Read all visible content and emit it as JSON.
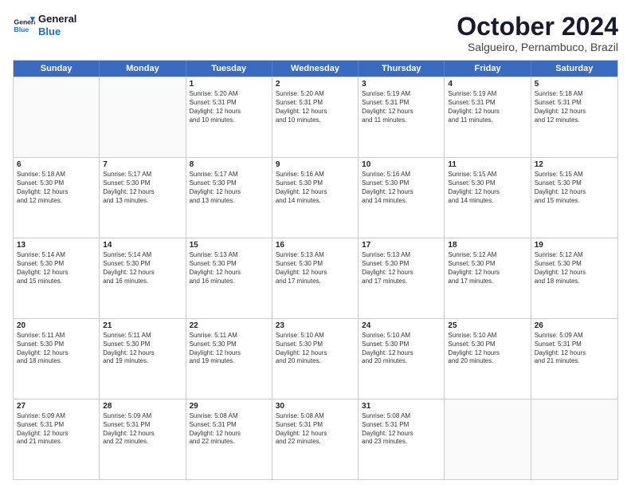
{
  "logo": {
    "line1": "General",
    "line2": "Blue"
  },
  "title": "October 2024",
  "location": "Salgueiro, Pernambuco, Brazil",
  "header_days": [
    "Sunday",
    "Monday",
    "Tuesday",
    "Wednesday",
    "Thursday",
    "Friday",
    "Saturday"
  ],
  "weeks": [
    [
      {
        "day": "",
        "text": ""
      },
      {
        "day": "",
        "text": ""
      },
      {
        "day": "1",
        "text": "Sunrise: 5:20 AM\nSunset: 5:31 PM\nDaylight: 12 hours\nand 10 minutes."
      },
      {
        "day": "2",
        "text": "Sunrise: 5:20 AM\nSunset: 5:31 PM\nDaylight: 12 hours\nand 10 minutes."
      },
      {
        "day": "3",
        "text": "Sunrise: 5:19 AM\nSunset: 5:31 PM\nDaylight: 12 hours\nand 11 minutes."
      },
      {
        "day": "4",
        "text": "Sunrise: 5:19 AM\nSunset: 5:31 PM\nDaylight: 12 hours\nand 11 minutes."
      },
      {
        "day": "5",
        "text": "Sunrise: 5:18 AM\nSunset: 5:31 PM\nDaylight: 12 hours\nand 12 minutes."
      }
    ],
    [
      {
        "day": "6",
        "text": "Sunrise: 5:18 AM\nSunset: 5:30 PM\nDaylight: 12 hours\nand 12 minutes."
      },
      {
        "day": "7",
        "text": "Sunrise: 5:17 AM\nSunset: 5:30 PM\nDaylight: 12 hours\nand 13 minutes."
      },
      {
        "day": "8",
        "text": "Sunrise: 5:17 AM\nSunset: 5:30 PM\nDaylight: 12 hours\nand 13 minutes."
      },
      {
        "day": "9",
        "text": "Sunrise: 5:16 AM\nSunset: 5:30 PM\nDaylight: 12 hours\nand 14 minutes."
      },
      {
        "day": "10",
        "text": "Sunrise: 5:16 AM\nSunset: 5:30 PM\nDaylight: 12 hours\nand 14 minutes."
      },
      {
        "day": "11",
        "text": "Sunrise: 5:15 AM\nSunset: 5:30 PM\nDaylight: 12 hours\nand 14 minutes."
      },
      {
        "day": "12",
        "text": "Sunrise: 5:15 AM\nSunset: 5:30 PM\nDaylight: 12 hours\nand 15 minutes."
      }
    ],
    [
      {
        "day": "13",
        "text": "Sunrise: 5:14 AM\nSunset: 5:30 PM\nDaylight: 12 hours\nand 15 minutes."
      },
      {
        "day": "14",
        "text": "Sunrise: 5:14 AM\nSunset: 5:30 PM\nDaylight: 12 hours\nand 16 minutes."
      },
      {
        "day": "15",
        "text": "Sunrise: 5:13 AM\nSunset: 5:30 PM\nDaylight: 12 hours\nand 16 minutes."
      },
      {
        "day": "16",
        "text": "Sunrise: 5:13 AM\nSunset: 5:30 PM\nDaylight: 12 hours\nand 17 minutes."
      },
      {
        "day": "17",
        "text": "Sunrise: 5:13 AM\nSunset: 5:30 PM\nDaylight: 12 hours\nand 17 minutes."
      },
      {
        "day": "18",
        "text": "Sunrise: 5:12 AM\nSunset: 5:30 PM\nDaylight: 12 hours\nand 17 minutes."
      },
      {
        "day": "19",
        "text": "Sunrise: 5:12 AM\nSunset: 5:30 PM\nDaylight: 12 hours\nand 18 minutes."
      }
    ],
    [
      {
        "day": "20",
        "text": "Sunrise: 5:11 AM\nSunset: 5:30 PM\nDaylight: 12 hours\nand 18 minutes."
      },
      {
        "day": "21",
        "text": "Sunrise: 5:11 AM\nSunset: 5:30 PM\nDaylight: 12 hours\nand 19 minutes."
      },
      {
        "day": "22",
        "text": "Sunrise: 5:11 AM\nSunset: 5:30 PM\nDaylight: 12 hours\nand 19 minutes."
      },
      {
        "day": "23",
        "text": "Sunrise: 5:10 AM\nSunset: 5:30 PM\nDaylight: 12 hours\nand 20 minutes."
      },
      {
        "day": "24",
        "text": "Sunrise: 5:10 AM\nSunset: 5:30 PM\nDaylight: 12 hours\nand 20 minutes."
      },
      {
        "day": "25",
        "text": "Sunrise: 5:10 AM\nSunset: 5:30 PM\nDaylight: 12 hours\nand 20 minutes."
      },
      {
        "day": "26",
        "text": "Sunrise: 5:09 AM\nSunset: 5:31 PM\nDaylight: 12 hours\nand 21 minutes."
      }
    ],
    [
      {
        "day": "27",
        "text": "Sunrise: 5:09 AM\nSunset: 5:31 PM\nDaylight: 12 hours\nand 21 minutes."
      },
      {
        "day": "28",
        "text": "Sunrise: 5:09 AM\nSunset: 5:31 PM\nDaylight: 12 hours\nand 22 minutes."
      },
      {
        "day": "29",
        "text": "Sunrise: 5:08 AM\nSunset: 5:31 PM\nDaylight: 12 hours\nand 22 minutes."
      },
      {
        "day": "30",
        "text": "Sunrise: 5:08 AM\nSunset: 5:31 PM\nDaylight: 12 hours\nand 22 minutes."
      },
      {
        "day": "31",
        "text": "Sunrise: 5:08 AM\nSunset: 5:31 PM\nDaylight: 12 hours\nand 23 minutes."
      },
      {
        "day": "",
        "text": ""
      },
      {
        "day": "",
        "text": ""
      }
    ]
  ]
}
